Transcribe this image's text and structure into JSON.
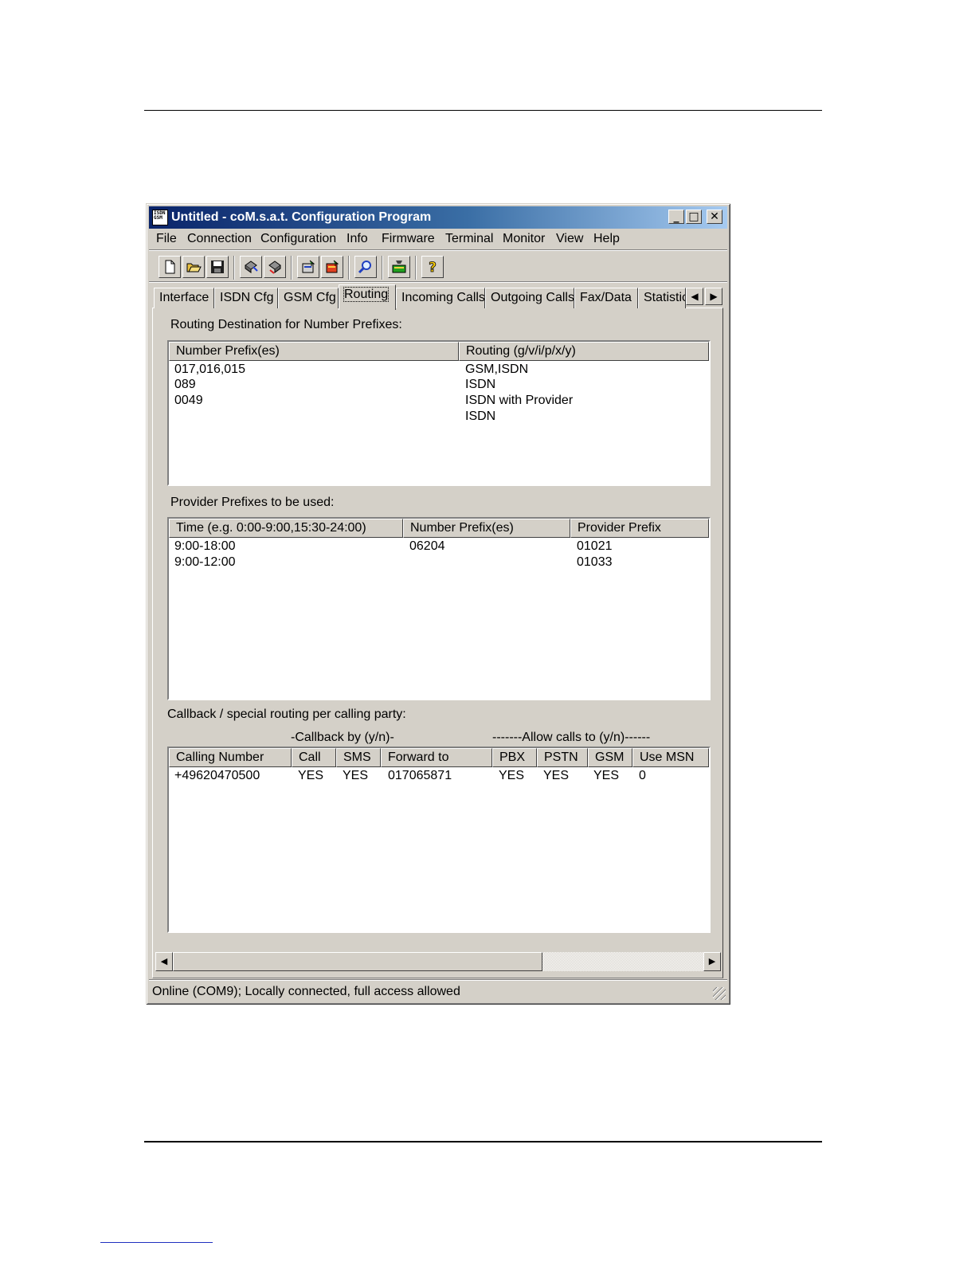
{
  "window": {
    "title": "Untitled - coM.s.a.t. Configuration Program",
    "icon_text": "ISDN GSM",
    "caption_buttons": {
      "minimize": "_",
      "maximize": "□",
      "close": "✕"
    }
  },
  "menu": [
    "File",
    "Connection",
    "Configuration",
    "Info",
    "Firmware",
    "Terminal",
    "Monitor",
    "View",
    "Help"
  ],
  "toolbar": [
    "new-icon",
    "open-icon",
    "save-icon",
    "read-config-icon",
    "write-config-icon",
    "upload-icon",
    "download-icon",
    "search-icon",
    "terminal-icon",
    "help-icon"
  ],
  "tabs": {
    "items": [
      "Interface",
      "ISDN Cfg",
      "GSM Cfg",
      "Routing",
      "Incoming Calls",
      "Outgoing Calls",
      "Fax/Data",
      "Statistic:"
    ],
    "active": "Routing",
    "scroll_left": "◀",
    "scroll_right": "▶"
  },
  "routing": {
    "label": "Routing Destination for Number Prefixes:",
    "columns": [
      "Number Prefix(es)",
      "Routing (g/v/i/p/x/y)"
    ],
    "rows": [
      [
        "017,016,015",
        "GSM,ISDN"
      ],
      [
        "089",
        "ISDN"
      ],
      [
        "0049",
        "ISDN with Provider"
      ],
      [
        "",
        "ISDN"
      ]
    ]
  },
  "provider": {
    "label": "Provider Prefixes to be used:",
    "columns": [
      "Time (e.g. 0:00-9:00,15:30-24:00)",
      "Number Prefix(es)",
      "Provider Prefix"
    ],
    "rows": [
      [
        "9:00-18:00",
        "06204",
        "01021"
      ],
      [
        "9:00-12:00",
        "",
        "01033"
      ]
    ]
  },
  "callback": {
    "label": "Callback / special routing per calling party:",
    "group_callback": "-Callback by (y/n)-",
    "group_allow": "-------Allow calls to (y/n)------",
    "columns": [
      "Calling Number",
      "Call",
      "SMS",
      "Forward to",
      "PBX",
      "PSTN",
      "GSM",
      "Use MSN"
    ],
    "rows": [
      [
        "+49620470500",
        "YES",
        "YES",
        "017065871",
        "YES",
        "YES",
        "YES",
        "0"
      ]
    ]
  },
  "scrollbar": {
    "left": "◀",
    "right": "▶"
  },
  "status": "Online (COM9); Locally connected, full access allowed"
}
